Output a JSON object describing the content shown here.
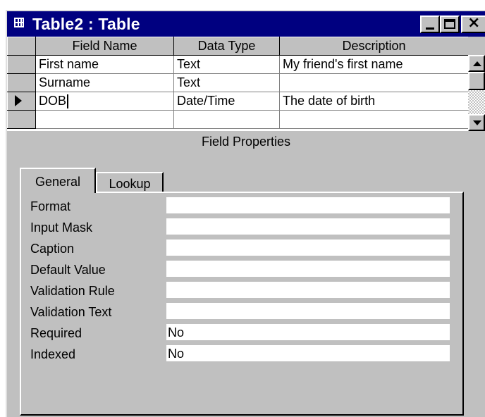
{
  "window": {
    "title": "Table2 : Table",
    "close_glyph": "×"
  },
  "grid": {
    "columns": [
      "Field Name",
      "Data Type",
      "Description"
    ],
    "rows": [
      {
        "field_name": "First name",
        "data_type": "Text",
        "description": "My friend's first name"
      },
      {
        "field_name": "Surname",
        "data_type": "Text",
        "description": ""
      },
      {
        "field_name": "DOB",
        "data_type": "Date/Time",
        "description": "The date of birth"
      },
      {
        "field_name": "",
        "data_type": "",
        "description": ""
      }
    ],
    "current_row_index": 2
  },
  "field_properties": {
    "title": "Field Properties",
    "tabs": [
      {
        "label": "General",
        "active": true
      },
      {
        "label": "Lookup",
        "active": false
      }
    ],
    "properties": [
      {
        "label": "Format",
        "value": ""
      },
      {
        "label": "Input Mask",
        "value": ""
      },
      {
        "label": "Caption",
        "value": ""
      },
      {
        "label": "Default Value",
        "value": ""
      },
      {
        "label": "Validation Rule",
        "value": ""
      },
      {
        "label": "Validation Text",
        "value": ""
      },
      {
        "label": "Required",
        "value": "No"
      },
      {
        "label": "Indexed",
        "value": "No"
      }
    ]
  },
  "colors": {
    "title_bar": "#000080",
    "face": "#c0c0c0",
    "window": "#ffffff"
  }
}
